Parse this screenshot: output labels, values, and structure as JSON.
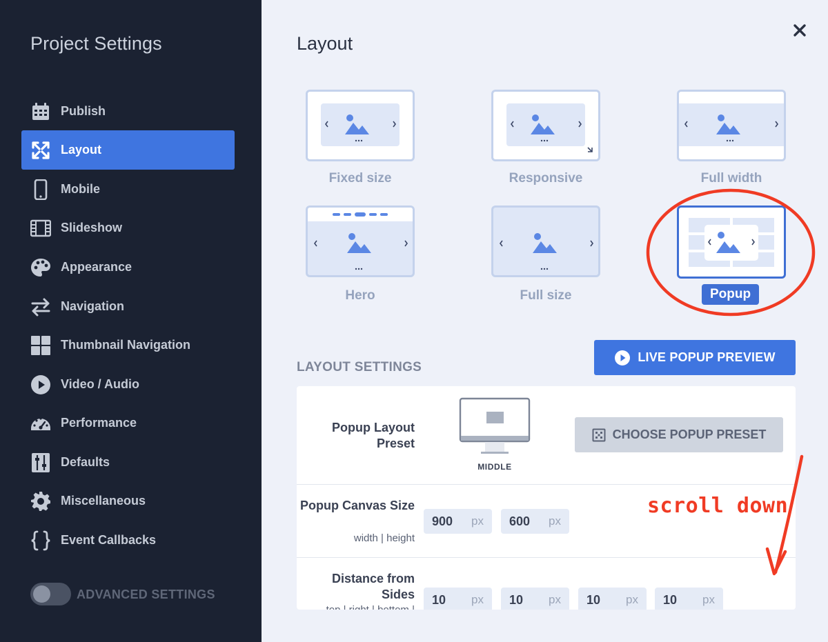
{
  "sidebar": {
    "title": "Project Settings",
    "items": [
      {
        "label": "Publish",
        "icon": "calendar-icon"
      },
      {
        "label": "Layout",
        "icon": "expand-arrows-icon",
        "active": true
      },
      {
        "label": "Mobile",
        "icon": "mobile-phone-icon"
      },
      {
        "label": "Slideshow",
        "icon": "film-strip-icon"
      },
      {
        "label": "Appearance",
        "icon": "palette-icon"
      },
      {
        "label": "Navigation",
        "icon": "swap-arrows-icon"
      },
      {
        "label": "Thumbnail Navigation",
        "icon": "grid-icon"
      },
      {
        "label": "Video / Audio",
        "icon": "play-circle-icon"
      },
      {
        "label": "Performance",
        "icon": "speedometer-icon"
      },
      {
        "label": "Defaults",
        "icon": "sliders-icon"
      },
      {
        "label": "Miscellaneous",
        "icon": "gear-icon"
      },
      {
        "label": "Event Callbacks",
        "icon": "curly-braces-icon"
      }
    ],
    "advanced_label": "ADVANCED SETTINGS",
    "advanced_enabled": false
  },
  "main": {
    "title": "Layout",
    "layouts": [
      {
        "label": "Fixed size"
      },
      {
        "label": "Responsive"
      },
      {
        "label": "Full width"
      },
      {
        "label": "Hero"
      },
      {
        "label": "Full size"
      },
      {
        "label": "Popup",
        "selected": true
      }
    ],
    "layout_settings_title": "LAYOUT SETTINGS",
    "live_preview_label": "LIVE POPUP PREVIEW",
    "preset": {
      "label": "Popup Layout Preset",
      "monitor_caption": "MIDDLE",
      "button_label": "CHOOSE POPUP PRESET"
    },
    "canvas_size": {
      "label": "Popup Canvas Size",
      "sub": "width | height",
      "width": "900",
      "height": "600",
      "unit": "px"
    },
    "distance": {
      "label": "Distance from Sides",
      "sub": "top | right | bottom |",
      "values": [
        "10",
        "10",
        "10",
        "10"
      ],
      "unit": "px"
    }
  },
  "annotation": {
    "text": "scroll down",
    "color": "#f03b24"
  },
  "colors": {
    "sidebar_bg": "#1b2232",
    "accent": "#3f75e0",
    "main_bg": "#eef1f9"
  }
}
